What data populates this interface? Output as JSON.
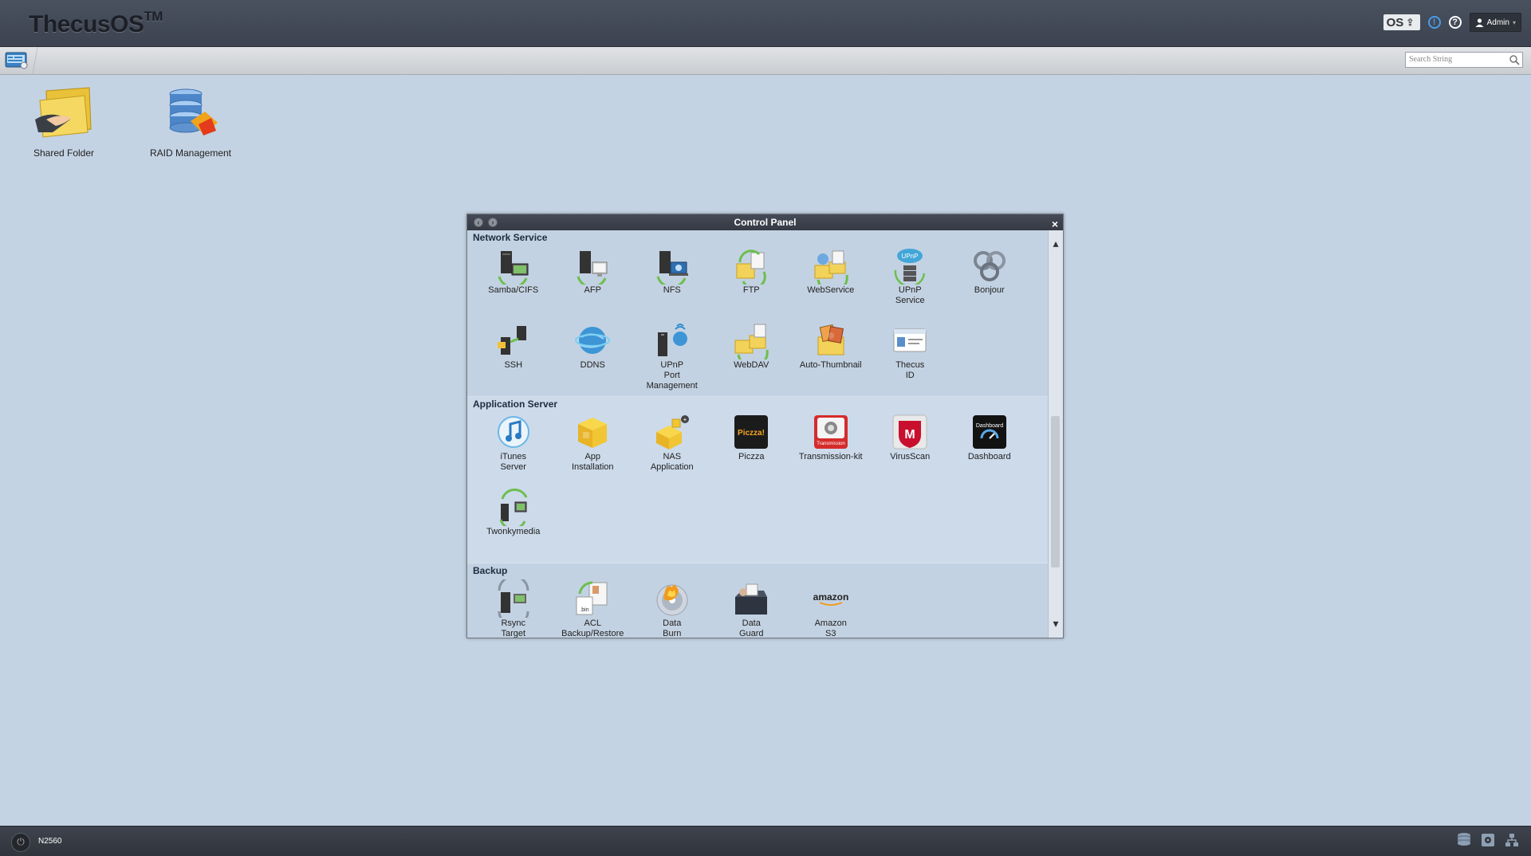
{
  "header": {
    "logo_text": "ThecusOS",
    "logo_tm": "TM",
    "os_button_label": "OS",
    "info_icon_label": "!",
    "help_icon_label": "?",
    "user_label": "Admin"
  },
  "toolbar": {
    "search_placeholder": "Search String"
  },
  "desktop": {
    "icons": [
      {
        "label": "Shared Folder",
        "icon": "shared-folder-icon"
      },
      {
        "label": "RAID Management",
        "icon": "raid-management-icon"
      }
    ]
  },
  "control_panel": {
    "title": "Control Panel",
    "sections": [
      {
        "title": "Network Service",
        "items": [
          {
            "label": "Samba/CIFS",
            "icon": "samba-icon"
          },
          {
            "label": "AFP",
            "icon": "afp-icon"
          },
          {
            "label": "NFS",
            "icon": "nfs-icon"
          },
          {
            "label": "FTP",
            "icon": "ftp-icon"
          },
          {
            "label": "WebService",
            "icon": "webservice-icon"
          },
          {
            "label": "UPnP\nService",
            "icon": "upnp-service-icon"
          },
          {
            "label": "Bonjour",
            "icon": "bonjour-icon"
          },
          {
            "label": "SSH",
            "icon": "ssh-icon"
          },
          {
            "label": "DDNS",
            "icon": "ddns-icon"
          },
          {
            "label": "UPnP\nPort\nManagement",
            "icon": "upnp-port-icon"
          },
          {
            "label": "WebDAV",
            "icon": "webdav-icon"
          },
          {
            "label": "Auto-Thumbnail",
            "icon": "auto-thumbnail-icon"
          },
          {
            "label": "Thecus\nID",
            "icon": "thecus-id-icon"
          }
        ]
      },
      {
        "title": "Application Server",
        "items": [
          {
            "label": "iTunes\nServer",
            "icon": "itunes-icon"
          },
          {
            "label": "App\nInstallation",
            "icon": "app-installation-icon"
          },
          {
            "label": "NAS\nApplication",
            "icon": "nas-application-icon"
          },
          {
            "label": "Piczza",
            "icon": "piczza-icon",
            "badge": "Piczza!"
          },
          {
            "label": "Transmission-kit",
            "icon": "transmission-icon",
            "badge": "Transmission"
          },
          {
            "label": "VirusScan",
            "icon": "virusscan-icon",
            "badge": "M"
          },
          {
            "label": "Dashboard",
            "icon": "dashboard-icon",
            "badge": "Dashboard"
          },
          {
            "label": "Twonkymedia",
            "icon": "twonkymedia-icon"
          }
        ]
      },
      {
        "title": "Backup",
        "items": [
          {
            "label": "Rsync\nTarget",
            "icon": "rsync-icon"
          },
          {
            "label": "ACL\nBackup/Restore",
            "icon": "acl-backup-icon"
          },
          {
            "label": "Data\nBurn",
            "icon": "data-burn-icon"
          },
          {
            "label": "Data\nGuard",
            "icon": "data-guard-icon"
          },
          {
            "label": "Amazon\nS3",
            "icon": "amazon-s3-icon",
            "badge": "amazon"
          }
        ]
      }
    ]
  },
  "taskbar": {
    "model": "N2560"
  },
  "colors": {
    "desktop_bg": "#c4d3e3",
    "header_bg": "#444a56",
    "window_title_bg": "#3b404a",
    "section_title": "#1e2c3e"
  }
}
